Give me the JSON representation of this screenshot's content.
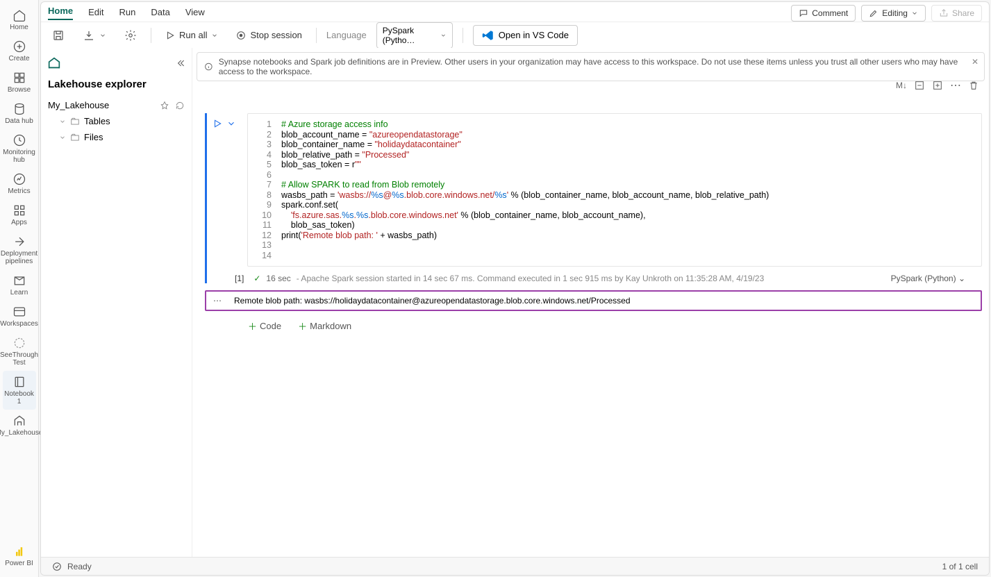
{
  "rail": [
    {
      "label": "Home"
    },
    {
      "label": "Create"
    },
    {
      "label": "Browse"
    },
    {
      "label": "Data hub"
    },
    {
      "label": "Monitoring hub"
    },
    {
      "label": "Metrics"
    },
    {
      "label": "Apps"
    },
    {
      "label": "Deployment pipelines"
    },
    {
      "label": "Learn"
    },
    {
      "label": "Workspaces"
    },
    {
      "label": "SeeThrough Test"
    },
    {
      "label": "Notebook 1",
      "active": true
    },
    {
      "label": "My_Lakehouse"
    }
  ],
  "rail_bottom": "Power BI",
  "menu": [
    "Home",
    "Edit",
    "Run",
    "Data",
    "View"
  ],
  "menu_active": "Home",
  "top_buttons": {
    "comment": "Comment",
    "editing": "Editing",
    "share": "Share"
  },
  "toolbar": {
    "run_all": "Run all",
    "stop": "Stop session",
    "language_label": "Language",
    "language_value": "PySpark (Pytho…",
    "vscode": "Open in VS Code"
  },
  "explorer": {
    "title": "Lakehouse explorer",
    "lakehouse": "My_Lakehouse",
    "nodes": [
      "Tables",
      "Files"
    ]
  },
  "banner": "Synapse notebooks and Spark job definitions are in Preview. Other users in your organization may have access to this workspace. Do not use these items unless you trust all other users who may have access to the workspace.",
  "cell_toolbar": {
    "md": "M↓"
  },
  "code_lines": [
    {
      "n": 1,
      "html": "<span class='c-comment'># Azure storage access info</span>"
    },
    {
      "n": 2,
      "html": "blob_account_name = <span class='c-str'>\"azureopendatastorage\"</span>"
    },
    {
      "n": 3,
      "html": "blob_container_name = <span class='c-str'>\"holidaydatacontainer\"</span>"
    },
    {
      "n": 4,
      "html": "blob_relative_path = <span class='c-str'>\"Processed\"</span>"
    },
    {
      "n": 5,
      "html": "blob_sas_token = r<span class='c-str'>\"\"</span>"
    },
    {
      "n": 6,
      "html": ""
    },
    {
      "n": 7,
      "html": "<span class='c-comment'># Allow SPARK to read from Blob remotely</span>"
    },
    {
      "n": 8,
      "html": "wasbs_path = <span class='c-str'>'wasbs://</span><span class='c-fmt'>%s</span><span class='c-str'>@</span><span class='c-fmt'>%s</span><span class='c-str'>.blob.core.windows.net/</span><span class='c-fmt'>%s</span><span class='c-str'>'</span> % (blob_container_name, blob_account_name, blob_relative_path)"
    },
    {
      "n": 9,
      "html": "spark.conf.set("
    },
    {
      "n": 10,
      "html": "    <span class='c-str'>'fs.azure.sas.</span><span class='c-fmt'>%s</span><span class='c-str'>.</span><span class='c-fmt'>%s</span><span class='c-str'>.blob.core.windows.net'</span> % (blob_container_name, blob_account_name),"
    },
    {
      "n": 11,
      "html": "    blob_sas_token)"
    },
    {
      "n": 12,
      "html": "print(<span class='c-str'>'Remote blob path: '</span> + wasbs_path)"
    },
    {
      "n": 13,
      "html": ""
    },
    {
      "n": 14,
      "html": ""
    }
  ],
  "exec": {
    "idx": "[1]",
    "time": "16 sec",
    "msg": "- Apache Spark session started in 14 sec 67 ms. Command executed in 1 sec 915 ms by Kay Unkroth on 11:35:28 AM, 4/19/23",
    "lang": "PySpark (Python)"
  },
  "output": "Remote blob path: wasbs://holidaydatacontainer@azureopendatastorage.blob.core.windows.net/Processed",
  "add": {
    "code": "Code",
    "markdown": "Markdown"
  },
  "status": {
    "left": "Ready",
    "right": "1 of 1 cell"
  }
}
